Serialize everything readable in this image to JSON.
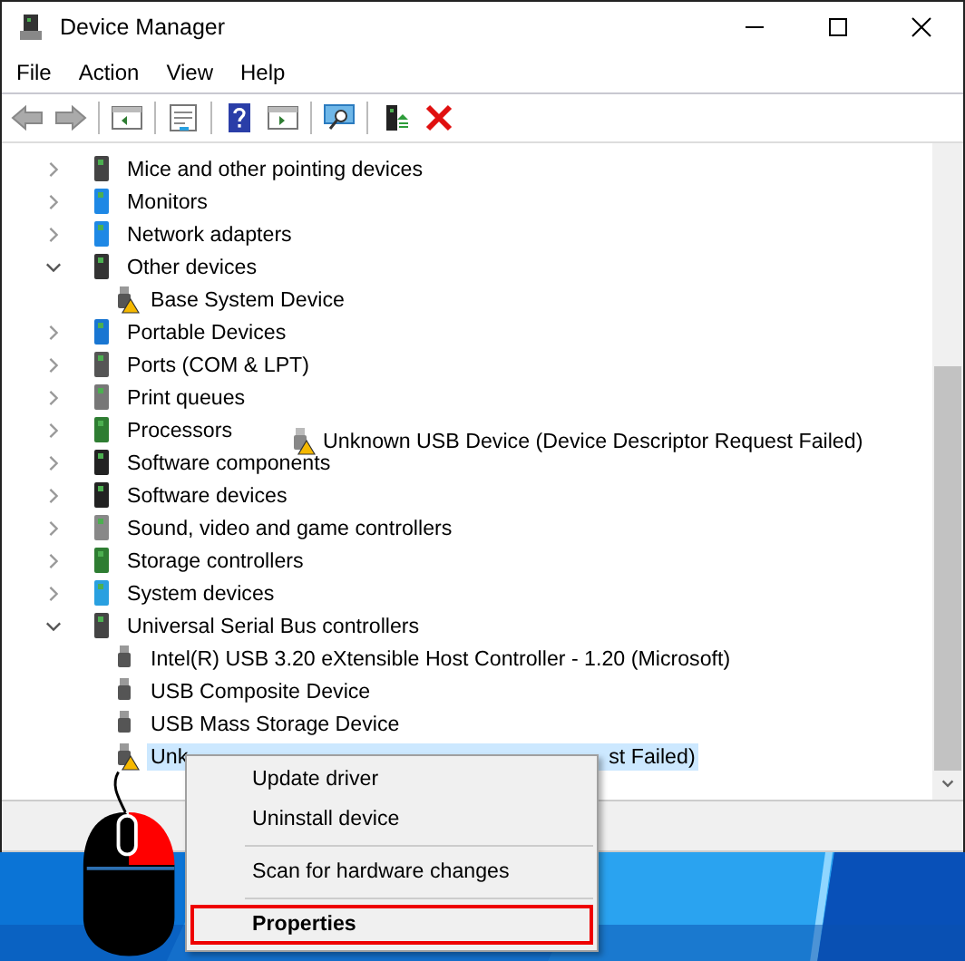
{
  "window": {
    "title": "Device Manager"
  },
  "menu": [
    "File",
    "Action",
    "View",
    "Help"
  ],
  "tree": [
    {
      "label": "Mice and other pointing devices",
      "expanded": false,
      "selected": false
    },
    {
      "label": "Monitors",
      "expanded": false,
      "selected": false
    },
    {
      "label": "Network adapters",
      "expanded": false,
      "selected": false
    },
    {
      "label": "Other devices",
      "expanded": true,
      "selected": false,
      "children": [
        {
          "label": "Base System Device",
          "warning": true,
          "selected": false
        }
      ]
    },
    {
      "label": "Portable Devices",
      "expanded": false,
      "selected": false
    },
    {
      "label": "Ports (COM & LPT)",
      "expanded": false,
      "selected": false
    },
    {
      "label": "Print queues",
      "expanded": false,
      "selected": false
    },
    {
      "label": "Processors",
      "expanded": false,
      "selected": false
    },
    {
      "label": "Software components",
      "expanded": false,
      "selected": false
    },
    {
      "label": "Software devices",
      "expanded": false,
      "selected": false
    },
    {
      "label": "Sound, video and game controllers",
      "expanded": false,
      "selected": false
    },
    {
      "label": "Storage controllers",
      "expanded": false,
      "selected": false
    },
    {
      "label": "System devices",
      "expanded": false,
      "selected": false
    },
    {
      "label": "Universal Serial Bus controllers",
      "expanded": true,
      "selected": false,
      "children": [
        {
          "label": "Intel(R) USB 3.20 eXtensible Host Controller - 1.20 (Microsoft)",
          "warning": false,
          "selected": false
        },
        {
          "label": "USB Composite Device",
          "warning": false,
          "selected": false
        },
        {
          "label": "USB Mass Storage Device",
          "warning": false,
          "selected": false
        },
        {
          "label_parts": [
            "Unk",
            "st Failed)"
          ],
          "warning": true,
          "selected": true
        }
      ]
    }
  ],
  "drag_ghost": {
    "label": "Unknown USB Device (Device Descriptor Request Failed)",
    "warning": true
  },
  "context_menu": [
    {
      "kind": "item",
      "label": "Update driver",
      "default": false,
      "selected": false
    },
    {
      "kind": "item",
      "label": "Uninstall device",
      "default": false,
      "selected": false
    },
    {
      "kind": "separator"
    },
    {
      "kind": "item",
      "label": "Scan for hardware changes",
      "default": false,
      "selected": false
    },
    {
      "kind": "separator"
    },
    {
      "kind": "item",
      "label": "Properties",
      "default": true,
      "selected": true
    }
  ]
}
